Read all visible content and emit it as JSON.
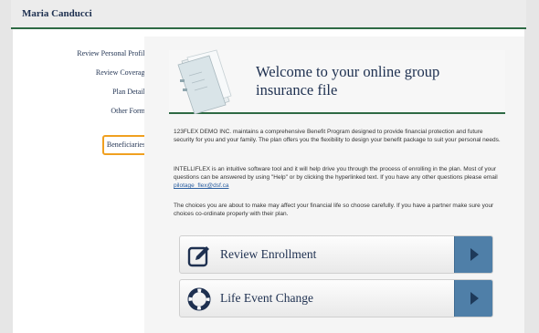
{
  "header": {
    "user_name": "Maria Canducci"
  },
  "sidebar": {
    "items": [
      {
        "label": "Review Personal Profile"
      },
      {
        "label": "Review Coverage"
      },
      {
        "label": "Plan Details"
      },
      {
        "label": "Other Forms"
      },
      {
        "label": "Beneficiaries"
      }
    ]
  },
  "welcome": {
    "title": "Welcome to your online group insurance file"
  },
  "paragraphs": {
    "p1": "123FLEX DEMO INC. maintains a comprehensive Benefit Program designed to provide financial protection and future security for you and your family. The plan offers you the flexibility to design your benefit package to suit your personal needs.",
    "p2_before": "INTELLIFLEX is an intuitive software tool and it will help drive you through the process of enrolling in the plan. Most of your questions can be answered by using \"Help\" or by clicking the hyperlinked text. If you have any other questions please email ",
    "p2_email": "pilotage_flex@dsf.ca",
    "p3": "The choices you are about to make may affect your financial life so choose carefully.  If you have a partner make sure your choices co-ordinate properly with their plan."
  },
  "actions": {
    "review": {
      "label": "Review Enrollment",
      "icon": "pencil-square-icon"
    },
    "life_event": {
      "label": "Life Event Change",
      "icon": "lifebuoy-icon"
    }
  },
  "colors": {
    "accent_green": "#2e6a44",
    "navy_text": "#1e3050",
    "action_blue": "#4f7fa8",
    "focus_orange": "#f0a020"
  }
}
